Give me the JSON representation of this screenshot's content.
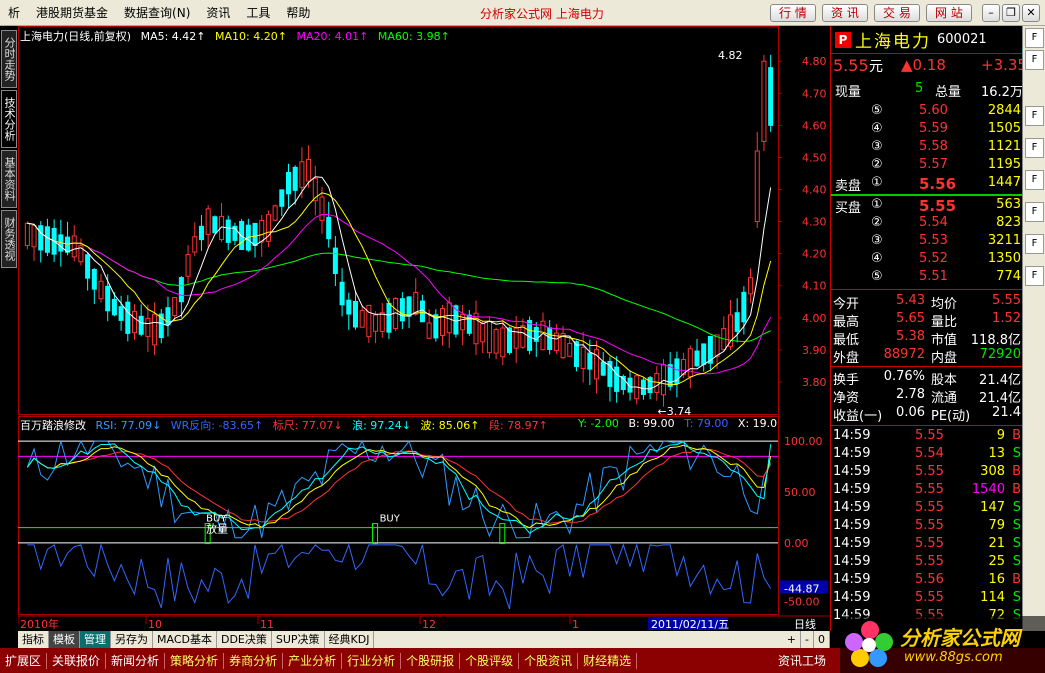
{
  "menubar": {
    "items": [
      "析",
      "港股期货基金",
      "数据查询(N)",
      "资讯",
      "工具",
      "帮助"
    ],
    "title": "分析家公式网 上海电力",
    "buttons": [
      "行 情",
      "资 讯",
      "交 易",
      "网 站"
    ]
  },
  "vtabs": [
    "分时走势",
    "技术分析",
    "基本资料",
    "财务透视"
  ],
  "main": {
    "stock_title": "上海电力(日线,前复权)",
    "ma": [
      {
        "label": "MA5: 4.42↑",
        "color": "#ffffff"
      },
      {
        "label": "MA10: 4.20↑",
        "color": "#ffff00"
      },
      {
        "label": "MA20: 4.01↑",
        "color": "#ff00ff"
      },
      {
        "label": "MA60: 3.98↑",
        "color": "#00ff00"
      }
    ],
    "price_axis": [
      "4.80",
      "4.70",
      "4.60",
      "4.50",
      "4.40",
      "4.30",
      "4.20",
      "4.10",
      "4.00",
      "3.90",
      "3.80"
    ],
    "high_label": "4.82",
    "low_label": "3.74"
  },
  "indicator": {
    "title": "百万踏浪修改",
    "items": [
      {
        "label": "RSI: 77.09↓",
        "color": "#3399ff"
      },
      {
        "label": "WR反向: -83.65↑",
        "color": "#3366ff"
      },
      {
        "label": "标尺: 77.07↓",
        "color": "#ff3232"
      },
      {
        "label": "浪: 97.24↓",
        "color": "#00ffff"
      },
      {
        "label": "波: 85.06↑",
        "color": "#ffff00"
      },
      {
        "label": "段: 78.97↑",
        "color": "#ff3232"
      }
    ],
    "xyz": [
      {
        "label": "Y: -2.00",
        "color": "#00ff00"
      },
      {
        "label": "B: 99.00",
        "color": "#ffffff"
      },
      {
        "label": "T: 79.00",
        "color": "#3366ff"
      },
      {
        "label": "X: 19.0",
        "color": "#ffffff"
      }
    ],
    "axis": [
      "100.00",
      "50.00",
      "0.00",
      "-44.87",
      "-50.00"
    ],
    "buy_labels": [
      "BUY",
      "放量",
      "BUY"
    ]
  },
  "xaxis": {
    "labels": [
      "2010年",
      "10",
      "11",
      "12",
      "1"
    ],
    "cursor_date": "2011/02/11/五",
    "period": "日线"
  },
  "quote": {
    "name": "上海电力",
    "code": "600021",
    "price": "5.55",
    "unit": "元",
    "change": "▲0.18",
    "change_pct": "+3.35",
    "now_vol_label": "现量",
    "now_vol": "5",
    "total_label": "总量",
    "total_vol": "16.2万",
    "sell": [
      {
        "lvl": "⑤",
        "price": "5.60",
        "vol": "2844"
      },
      {
        "lvl": "④",
        "price": "5.59",
        "vol": "1505"
      },
      {
        "lvl": "③",
        "price": "5.58",
        "vol": "1121"
      },
      {
        "lvl": "②",
        "price": "5.57",
        "vol": "1195"
      },
      {
        "lvl": "①",
        "price": "5.56",
        "vol": "1447"
      }
    ],
    "buy": [
      {
        "lvl": "①",
        "price": "5.55",
        "vol": "563"
      },
      {
        "lvl": "②",
        "price": "5.54",
        "vol": "823"
      },
      {
        "lvl": "③",
        "price": "5.53",
        "vol": "3211"
      },
      {
        "lvl": "④",
        "price": "5.52",
        "vol": "1350"
      },
      {
        "lvl": "⑤",
        "price": "5.51",
        "vol": "774"
      }
    ],
    "sell_label": "卖盘",
    "buy_label": "买盘",
    "stats": [
      {
        "l1": "今开",
        "v1": "5.43",
        "c1": "red",
        "l2": "均价",
        "v2": "5.55",
        "c2": "red"
      },
      {
        "l1": "最高",
        "v1": "5.65",
        "c1": "red",
        "l2": "量比",
        "v2": "1.52",
        "c2": "red"
      },
      {
        "l1": "最低",
        "v1": "5.38",
        "c1": "red",
        "l2": "市值",
        "v2": "118.8亿",
        "c2": "white"
      },
      {
        "l1": "外盘",
        "v1": "88972",
        "c1": "red",
        "l2": "内盘",
        "v2": "72920",
        "c2": "green"
      }
    ],
    "stats2": [
      {
        "l1": "换手",
        "v1": "0.76%",
        "l2": "股本",
        "v2": "21.4亿"
      },
      {
        "l1": "净资",
        "v1": "2.78",
        "l2": "流通",
        "v2": "21.4亿"
      },
      {
        "l1": "收益(一)",
        "v1": "0.06",
        "l2": "PE(动)",
        "v2": "21.4"
      }
    ],
    "ticks": [
      {
        "t": "14:59",
        "p": "5.55",
        "v": "9",
        "s": "B"
      },
      {
        "t": "14:59",
        "p": "5.54",
        "v": "13",
        "s": "S"
      },
      {
        "t": "14:59",
        "p": "5.55",
        "v": "308",
        "s": "B"
      },
      {
        "t": "14:59",
        "p": "5.55",
        "v": "1540",
        "s": "B"
      },
      {
        "t": "14:59",
        "p": "5.55",
        "v": "147",
        "s": "S"
      },
      {
        "t": "14:59",
        "p": "5.55",
        "v": "79",
        "s": "S"
      },
      {
        "t": "14:59",
        "p": "5.55",
        "v": "21",
        "s": "S"
      },
      {
        "t": "14:59",
        "p": "5.55",
        "v": "25",
        "s": "S"
      },
      {
        "t": "14:59",
        "p": "5.56",
        "v": "16",
        "s": "B"
      },
      {
        "t": "14:59",
        "p": "5.55",
        "v": "114",
        "s": "S"
      },
      {
        "t": "14:59",
        "p": "5.55",
        "v": "72",
        "s": "S"
      }
    ]
  },
  "bottombar1": [
    "指标",
    "模板",
    "管理",
    "另存为",
    "MACD基本",
    "DDE决策",
    "SUP决策",
    "经典KDJ"
  ],
  "bottombar1_right": [
    "+",
    "-",
    "0"
  ],
  "bottombar2": [
    "扩展区",
    "关联报价",
    "新闻分析",
    "策略分析",
    "券商分析",
    "产业分析",
    "行业分析",
    "个股研报",
    "个股评级",
    "个股资讯",
    "财经精选"
  ],
  "bottombar2_right": "资讯工场",
  "logo": {
    "text": "分析家公式网",
    "url": "www.88gs.com"
  },
  "colors": {
    "up": "#ff3232",
    "down": "#00ffff",
    "ma5": "#ffffff",
    "ma10": "#ffff00",
    "ma20": "#ff00ff",
    "ma60": "#00ff00"
  }
}
